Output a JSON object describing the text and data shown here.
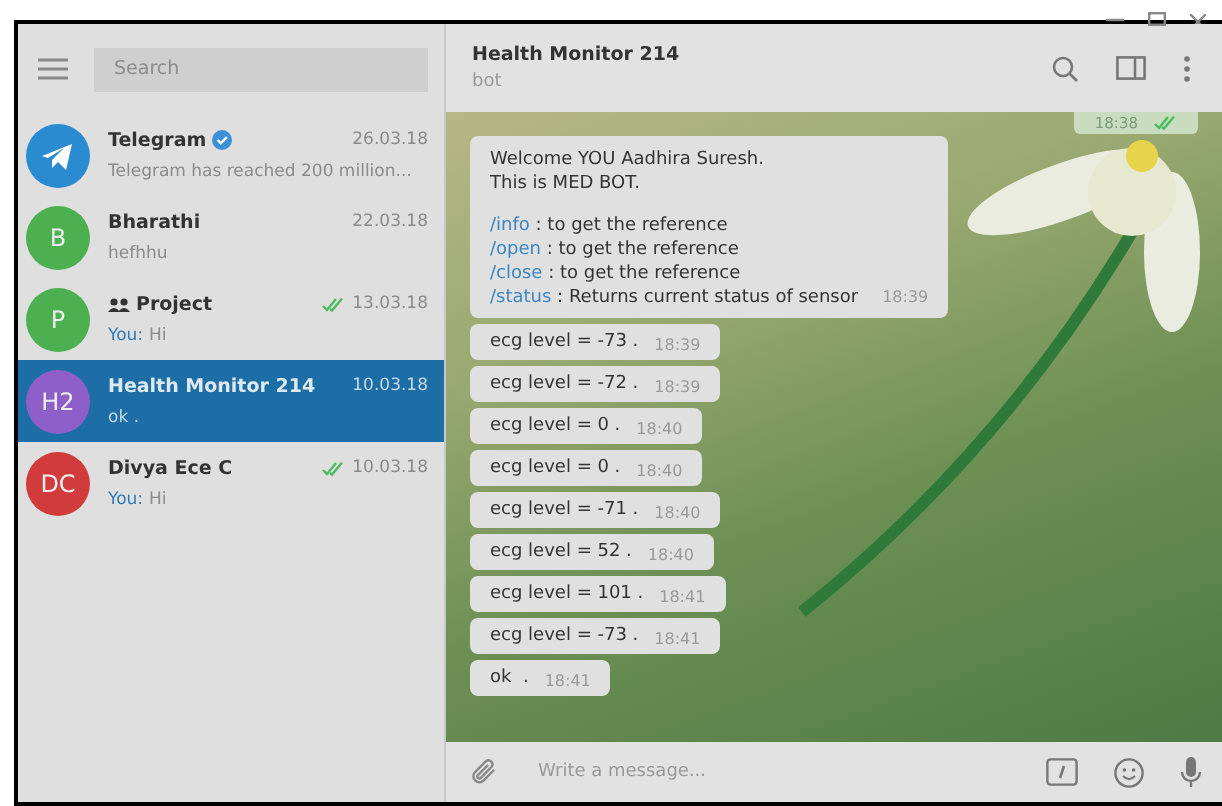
{
  "sidebar": {
    "search": {
      "placeholder": "Search"
    },
    "chats": [
      {
        "kind": "logo",
        "color": "#2a8bd0",
        "name": "Telegram",
        "verified": true,
        "group": false,
        "date": "26.03.18",
        "read": false,
        "preview": "Telegram has reached 200 million...",
        "selected": false
      },
      {
        "initials": "B",
        "kind": "initials",
        "color": "#4caf50",
        "name": "Bharathi",
        "verified": false,
        "group": false,
        "date": "22.03.18",
        "read": false,
        "preview": "hefhhu",
        "selected": false
      },
      {
        "initials": "P",
        "kind": "initials",
        "color": "#4caf50",
        "name": "Project",
        "verified": false,
        "group": true,
        "date": "13.03.18",
        "read": true,
        "sender": "You:",
        "preview": "Hi",
        "selected": false
      },
      {
        "initials": "H2",
        "kind": "initials",
        "color": "#8e5fc9",
        "name": "Health Monitor 214",
        "verified": false,
        "group": false,
        "date": "10.03.18",
        "read": false,
        "preview": "ok  .",
        "selected": true
      },
      {
        "initials": "DC",
        "kind": "initials",
        "color": "#d23b3b",
        "name": "Divya Ece C",
        "verified": false,
        "group": false,
        "date": "10.03.18",
        "read": true,
        "sender": "You:",
        "preview": "Hi",
        "selected": false
      }
    ]
  },
  "chat": {
    "title": "Health Monitor 214",
    "subtitle": "bot",
    "outgoing": {
      "time": "18:38",
      "read": true
    },
    "welcome": {
      "lines": [
        "Welcome YOU Aadhira Suresh.",
        "This is MED BOT."
      ],
      "commands": [
        {
          "command": "/info",
          "text": " : to get the reference"
        },
        {
          "command": "/open",
          "text": " : to get the reference"
        },
        {
          "command": "/close",
          "text": " : to get the reference"
        },
        {
          "command": "/status",
          "text": " : Returns current status of sensor"
        }
      ],
      "time": "18:39"
    },
    "messages": [
      {
        "text": "ecg level = -73 .",
        "time": "18:39"
      },
      {
        "text": "ecg level = -72 .",
        "time": "18:39"
      },
      {
        "text": "ecg level = 0 .",
        "time": "18:40"
      },
      {
        "text": "ecg level = 0 .",
        "time": "18:40"
      },
      {
        "text": "ecg level = -71 .",
        "time": "18:40"
      },
      {
        "text": "ecg level = 52 .",
        "time": "18:40"
      },
      {
        "text": "ecg level = 101 .",
        "time": "18:41"
      },
      {
        "text": "ecg level = -73 .",
        "time": "18:41"
      },
      {
        "text": "ok  .",
        "time": "18:41"
      }
    ],
    "composer": {
      "placeholder": "Write a message..."
    }
  }
}
